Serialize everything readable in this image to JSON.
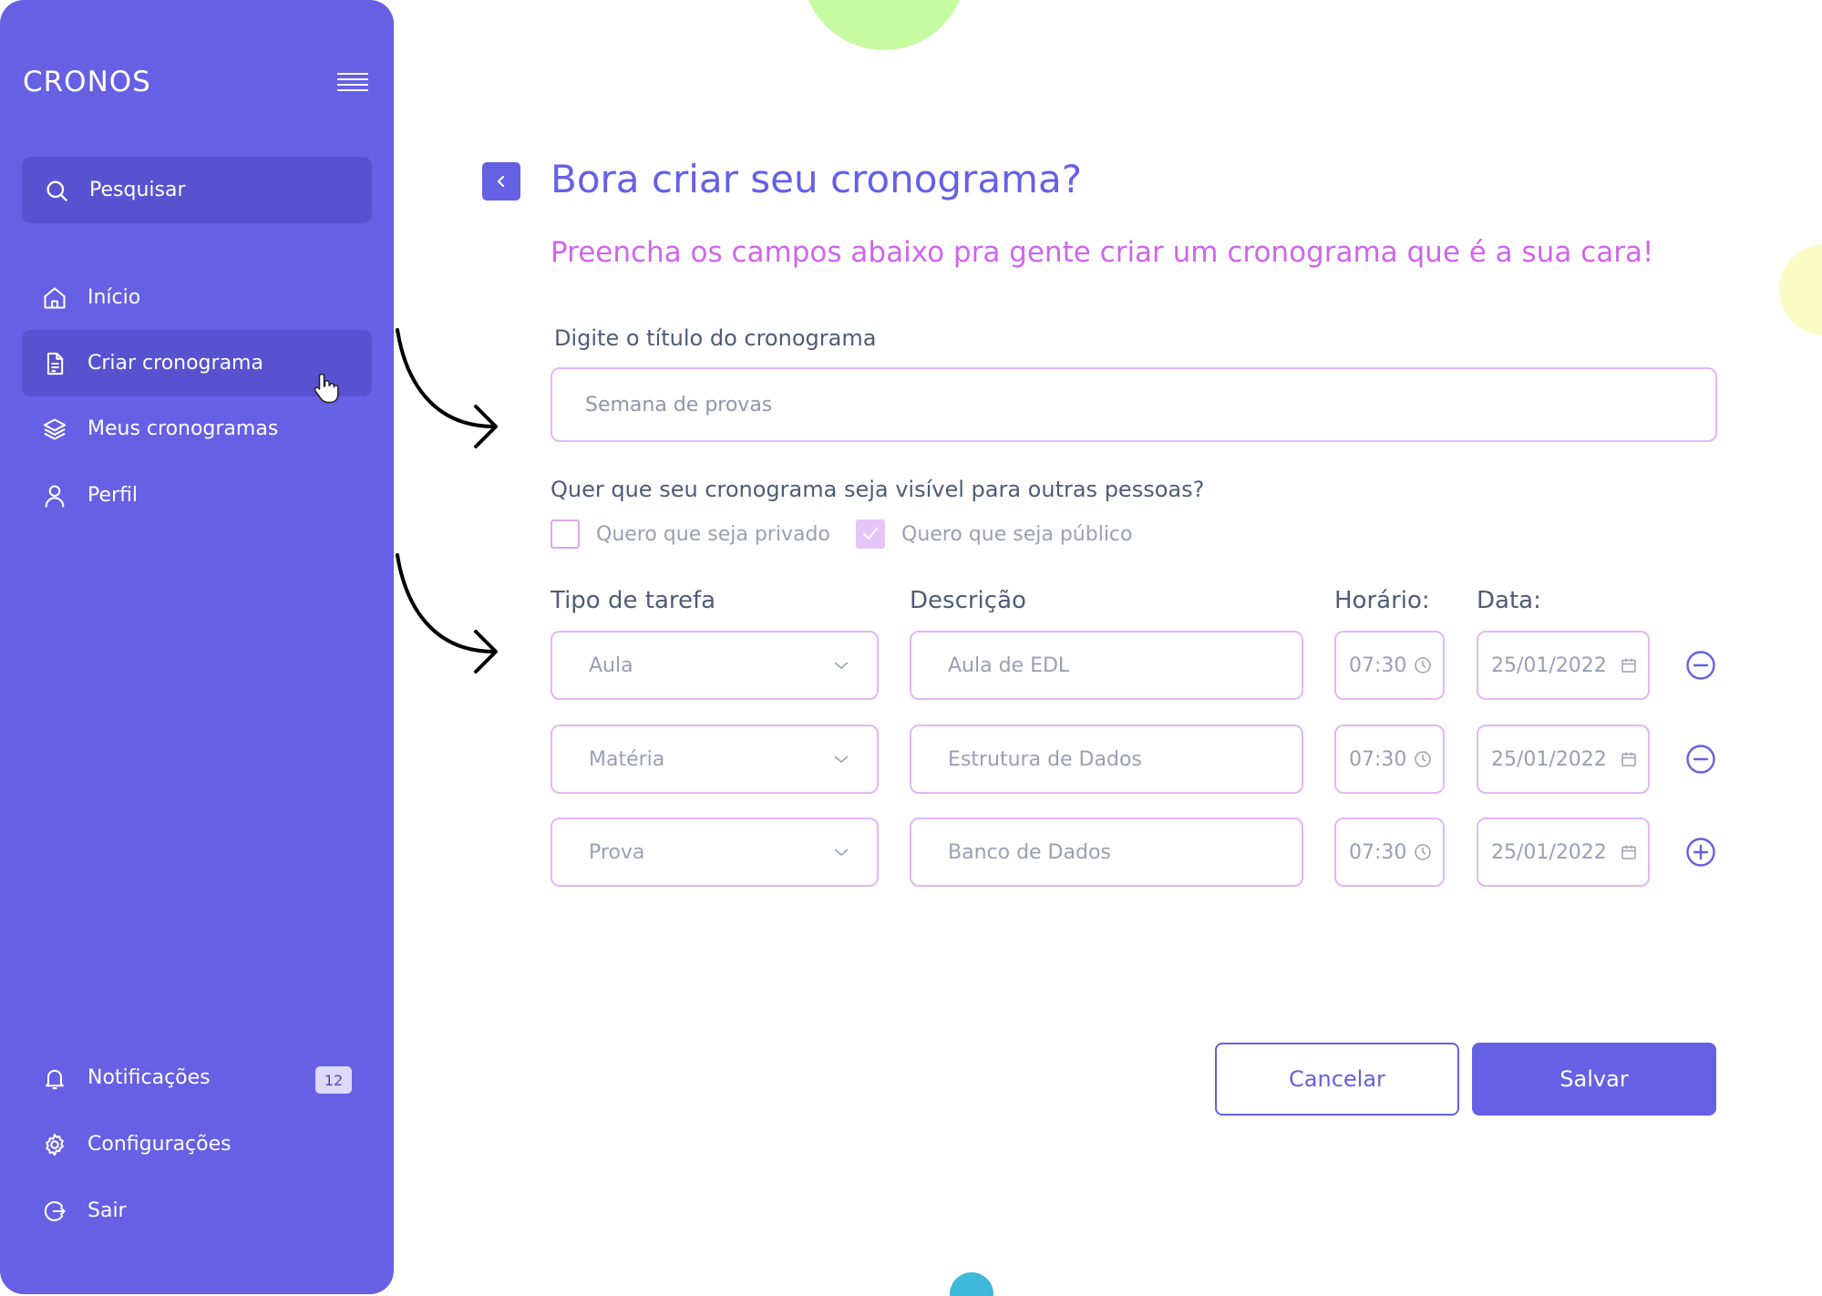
{
  "app": {
    "logo": "CRONOS"
  },
  "sidebar": {
    "search_label": "Pesquisar",
    "items": [
      {
        "label": "Início",
        "icon": "home-icon"
      },
      {
        "label": "Criar cronograma",
        "icon": "document-icon",
        "active": true
      },
      {
        "label": "Meus cronogramas",
        "icon": "layers-icon"
      },
      {
        "label": "Perfil",
        "icon": "user-icon"
      }
    ],
    "bottom_items": [
      {
        "label": "Notificações",
        "icon": "bell-icon",
        "badge": "12"
      },
      {
        "label": "Configurações",
        "icon": "gear-icon"
      },
      {
        "label": "Sair",
        "icon": "logout-icon"
      }
    ]
  },
  "main": {
    "title": "Bora criar seu cronograma?",
    "subtitle": "Preencha os campos abaixo pra gente criar um cronograma que é a sua cara!",
    "title_field": {
      "label": "Digite o título do cronograma",
      "placeholder": "Semana de provas"
    },
    "visibility": {
      "question": "Quer que seu cronograma seja visível para outras pessoas?",
      "private_label": "Quero que seja privado",
      "private_checked": false,
      "public_label": "Quero que seja público",
      "public_checked": true
    },
    "tasks": {
      "headers": {
        "type": "Tipo de tarefa",
        "description": "Descrição",
        "time": "Horário:",
        "date": "Data:"
      },
      "rows": [
        {
          "type": "Aula",
          "description": "Aula de EDL",
          "time": "07:30",
          "date": "25/01/2022",
          "action": "remove"
        },
        {
          "type": "Matéria",
          "description": "Estrutura de Dados",
          "time": "07:30",
          "date": "25/01/2022",
          "action": "remove"
        },
        {
          "type": "Prova",
          "description": "Banco de Dados",
          "time": "07:30",
          "date": "25/01/2022",
          "action": "add"
        }
      ]
    },
    "actions": {
      "cancel": "Cancelar",
      "save": "Salvar"
    }
  },
  "colors": {
    "primary": "#6560e4",
    "sidebar_active": "#5752cf",
    "accent_pink": "#cf66eb",
    "field_border": "#e3b6f4",
    "text": "#4f5b76",
    "muted_text": "#98a0b3"
  }
}
